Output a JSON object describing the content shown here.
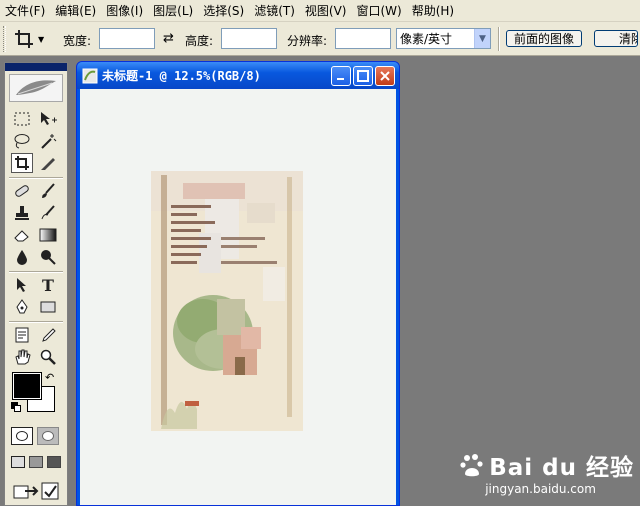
{
  "menu": [
    "文件(F)",
    "编辑(E)",
    "图像(I)",
    "图层(L)",
    "选择(S)",
    "滤镜(T)",
    "视图(V)",
    "窗口(W)",
    "帮助(H)"
  ],
  "options_bar": {
    "width_label": "宽度:",
    "width_value": "",
    "height_label": "高度:",
    "height_value": "",
    "resolution_label": "分辨率:",
    "resolution_value": "",
    "unit_select": "像素/英寸",
    "front_image_button": "前面的图像",
    "clear_button": "清除"
  },
  "document": {
    "title": "未标题-1 @ 12.5%(RGB/8)"
  },
  "watermark": {
    "brand": "Bai du 经验",
    "url": "jingyan.baidu.com"
  },
  "colors": {
    "title_blue": "#0054e3",
    "workspace": "#7a7a7a",
    "chrome": "#ece9d8"
  }
}
